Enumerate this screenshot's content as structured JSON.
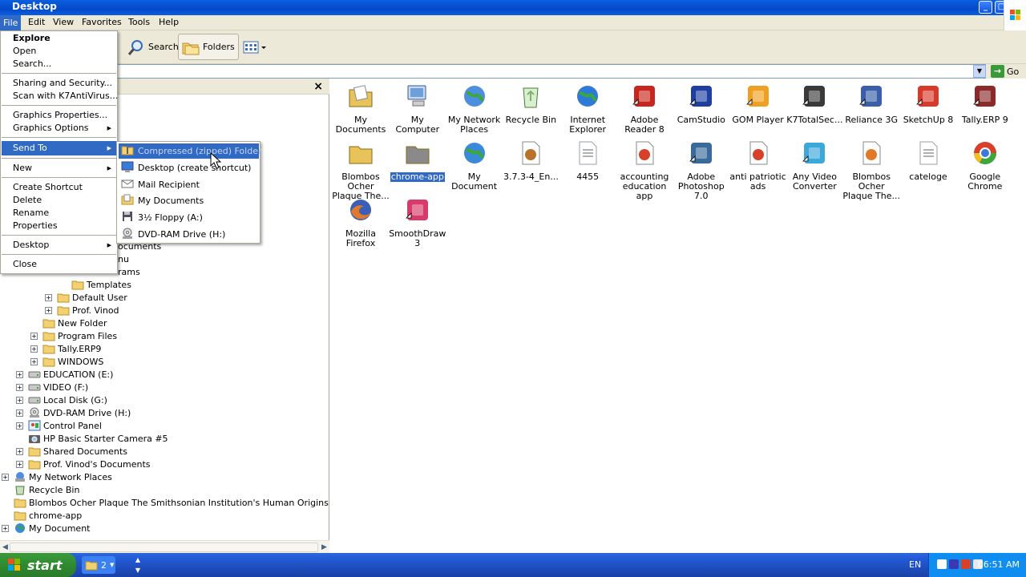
{
  "window": {
    "title": "Desktop"
  },
  "menubar": [
    "File",
    "Edit",
    "View",
    "Favorites",
    "Tools",
    "Help"
  ],
  "toolbar": {
    "search_label": "Search",
    "folders_label": "Folders"
  },
  "address": {
    "go_label": "Go"
  },
  "file_menu": {
    "items": [
      {
        "label": "Explore",
        "bold": true
      },
      {
        "label": "Open"
      },
      {
        "label": "Search..."
      },
      {
        "sep": true
      },
      {
        "label": "Sharing and Security..."
      },
      {
        "label": "Scan with K7AntiVirus..."
      },
      {
        "sep": true
      },
      {
        "label": "Graphics Properties..."
      },
      {
        "label": "Graphics Options",
        "submenu": true
      },
      {
        "sep": true
      },
      {
        "label": "Send To",
        "submenu": true,
        "highlight": true
      },
      {
        "sep": true
      },
      {
        "label": "New",
        "submenu": true
      },
      {
        "sep": true
      },
      {
        "label": "Create Shortcut"
      },
      {
        "label": "Delete"
      },
      {
        "label": "Rename"
      },
      {
        "label": "Properties"
      },
      {
        "sep": true
      },
      {
        "label": "Desktop",
        "submenu": true
      },
      {
        "sep": true
      },
      {
        "label": "Close"
      }
    ]
  },
  "send_to": [
    {
      "label": "Compressed (zipped) Folder",
      "icon": "zip-folder-icon",
      "highlight": true
    },
    {
      "label": "Desktop (create shortcut)",
      "icon": "desktop-icon"
    },
    {
      "label": "Mail Recipient",
      "icon": "mail-icon"
    },
    {
      "label": "My Documents",
      "icon": "documents-icon"
    },
    {
      "label": "3½ Floppy (A:)",
      "icon": "floppy-icon"
    },
    {
      "label": "DVD-RAM Drive (H:)",
      "icon": "dvd-drive-icon"
    }
  ],
  "tree": [
    {
      "label": "ocuments",
      "indent": 5,
      "icon": "",
      "exp": ""
    },
    {
      "label": "nu",
      "indent": 5,
      "icon": "",
      "exp": ""
    },
    {
      "label": "rams",
      "indent": 5,
      "icon": "",
      "exp": ""
    },
    {
      "label": "Templates",
      "indent": 4,
      "icon": "folder",
      "exp": ""
    },
    {
      "label": "Default User",
      "indent": 3,
      "icon": "folder",
      "exp": "+"
    },
    {
      "label": "Prof. Vinod",
      "indent": 3,
      "icon": "folder",
      "exp": "+"
    },
    {
      "label": "New Folder",
      "indent": 2,
      "icon": "folder",
      "exp": ""
    },
    {
      "label": "Program Files",
      "indent": 2,
      "icon": "folder",
      "exp": "+"
    },
    {
      "label": "Tally.ERP9",
      "indent": 2,
      "icon": "folder",
      "exp": "+"
    },
    {
      "label": "WINDOWS",
      "indent": 2,
      "icon": "folder",
      "exp": "+"
    },
    {
      "label": "EDUCATION (E:)",
      "indent": 1,
      "icon": "drive",
      "exp": "+"
    },
    {
      "label": "VIDEO (F:)",
      "indent": 1,
      "icon": "drive",
      "exp": "+"
    },
    {
      "label": "Local Disk (G:)",
      "indent": 1,
      "icon": "drive",
      "exp": "+"
    },
    {
      "label": "DVD-RAM Drive (H:)",
      "indent": 1,
      "icon": "dvd",
      "exp": "+"
    },
    {
      "label": "Control Panel",
      "indent": 1,
      "icon": "control",
      "exp": "+"
    },
    {
      "label": "HP Basic Starter Camera #5",
      "indent": 1,
      "icon": "camera",
      "exp": ""
    },
    {
      "label": "Shared Documents",
      "indent": 1,
      "icon": "folder",
      "exp": "+"
    },
    {
      "label": "Prof. Vinod's Documents",
      "indent": 1,
      "icon": "folder",
      "exp": "+"
    },
    {
      "label": "My Network Places",
      "indent": 0,
      "icon": "network",
      "exp": "+"
    },
    {
      "label": "Recycle Bin",
      "indent": 0,
      "icon": "recycle",
      "exp": ""
    },
    {
      "label": "Blombos Ocher Plaque   The Smithsonian Institution's Human Origins Program_files",
      "indent": 0,
      "icon": "folder",
      "exp": ""
    },
    {
      "label": "chrome-app",
      "indent": 0,
      "icon": "folder",
      "exp": ""
    },
    {
      "label": "My Document",
      "indent": 0,
      "icon": "globe",
      "exp": "+"
    }
  ],
  "desktop_icons": [
    {
      "label": "My Documents",
      "icon": "my-documents-icon",
      "color": "#e8c35a"
    },
    {
      "label": "My Computer",
      "icon": "my-computer-icon",
      "color": "#6f9fd8"
    },
    {
      "label": "My Network Places",
      "icon": "network-places-icon",
      "color": "#4d8ee0"
    },
    {
      "label": "Recycle Bin",
      "icon": "recycle-bin-icon",
      "color": "#7fb36f"
    },
    {
      "label": "Internet Explorer",
      "icon": "internet-explorer-icon",
      "color": "#2f7ad8"
    },
    {
      "label": "Adobe Reader 8",
      "icon": "adobe-reader-icon",
      "color": "#c8251c"
    },
    {
      "label": "CamStudio",
      "icon": "camstudio-icon",
      "color": "#1f3fa0"
    },
    {
      "label": "GOM Player",
      "icon": "gom-player-icon",
      "color": "#f0a020"
    },
    {
      "label": "K7TotalSec...",
      "icon": "k7-icon",
      "color": "#3a3a3a"
    },
    {
      "label": "Reliance 3G",
      "icon": "reliance-icon",
      "color": "#3a5fa8"
    },
    {
      "label": "SketchUp 8",
      "icon": "sketchup-icon",
      "color": "#d83a2a"
    },
    {
      "label": "Tally.ERP 9",
      "icon": "tally-icon",
      "color": "#8a2a2a"
    },
    {
      "label": "Blombos Ocher Plaque   The...",
      "icon": "folder-icon",
      "color": "#e8c35a"
    },
    {
      "label": "chrome-app",
      "icon": "folder-icon",
      "color": "#8a8a8a",
      "selected": true
    },
    {
      "label": "My Document",
      "icon": "globe-icon",
      "color": "#3a8ad8"
    },
    {
      "label": "3.7.3-4_En...",
      "icon": "archive-icon",
      "color": "#b8722a"
    },
    {
      "label": "4455",
      "icon": "text-file-icon",
      "color": "#9aa0a8"
    },
    {
      "label": "accounting education app",
      "icon": "document-icon",
      "color": "#d8402a"
    },
    {
      "label": "Adobe Photoshop 7.0",
      "icon": "photoshop-icon",
      "color": "#3a6a9a"
    },
    {
      "label": "anti patriotic ads",
      "icon": "document-icon",
      "color": "#d8402a"
    },
    {
      "label": "Any Video Converter",
      "icon": "video-converter-icon",
      "color": "#3aa8d8"
    },
    {
      "label": "Blombos Ocher Plaque   The...",
      "icon": "firefox-file-icon",
      "color": "#e07a2a"
    },
    {
      "label": "cateloge",
      "icon": "text-file-icon",
      "color": "#9aa0a8"
    },
    {
      "label": "Google Chrome",
      "icon": "chrome-icon",
      "color": "#d8402a"
    },
    {
      "label": "Mozilla Firefox",
      "icon": "firefox-icon",
      "color": "#e07a2a"
    },
    {
      "label": "SmoothDraw 3",
      "icon": "smoothdraw-icon",
      "color": "#d83a6a"
    }
  ],
  "taskbar": {
    "start_label": "start",
    "task_count": "2",
    "lang": "EN",
    "clock": "06:51 AM"
  }
}
